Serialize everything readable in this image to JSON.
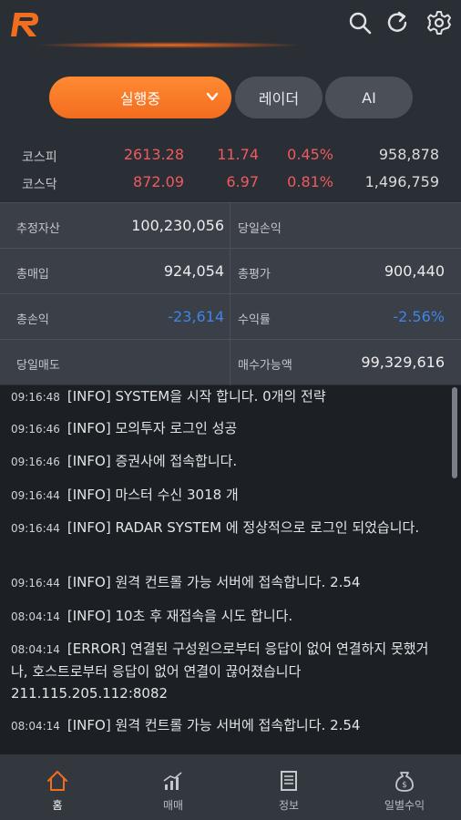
{
  "header": {
    "icons": [
      "search-icon",
      "refresh-icon",
      "settings-icon"
    ],
    "accent": "#f36d1f"
  },
  "tabs": [
    {
      "label": "실행중",
      "active": true
    },
    {
      "label": "레이더",
      "active": false
    },
    {
      "label": "AI",
      "active": false
    }
  ],
  "market": [
    {
      "name": "코스피",
      "value": "2613.28",
      "change": "11.74",
      "pct": "0.45%",
      "volume": "958,878"
    },
    {
      "name": "코스닥",
      "value": "872.09",
      "change": "6.97",
      "pct": "0.81%",
      "volume": "1,496,759"
    }
  ],
  "account": {
    "estimated_assets": {
      "label": "추정자산",
      "value": "100,230,056"
    },
    "daily_pnl": {
      "label": "당일손익",
      "value": ""
    },
    "total_buy": {
      "label": "총매입",
      "value": "924,054"
    },
    "total_eval": {
      "label": "총평가",
      "value": "900,440"
    },
    "total_pnl": {
      "label": "총손익",
      "value": "-23,614"
    },
    "return_rate": {
      "label": "수익률",
      "value": "-2.56%"
    },
    "daily_sell": {
      "label": "당일매도",
      "value": ""
    },
    "buyable": {
      "label": "매수가능액",
      "value": "99,329,616"
    }
  },
  "log": [
    {
      "time": "09:16:48",
      "message": "[INFO] SYSTEM을 시작 합니다. 0개의 전략"
    },
    {
      "time": "09:16:46",
      "message": "[INFO] 모의투자 로그인 성공"
    },
    {
      "time": "09:16:46",
      "message": "[INFO] 증권사에 접속합니다."
    },
    {
      "time": "09:16:44",
      "message": "[INFO] 마스터 수신 3018 개"
    },
    {
      "time": "09:16:44",
      "message": "[INFO] RADAR SYSTEM 에 정상적으로 로그인 되었습니다."
    },
    {
      "time": "09:16:44",
      "message": "[INFO] 원격 컨트롤 가능 서버에 접속합니다. 2.54"
    },
    {
      "time": "08:04:14",
      "message": "[INFO] 10초 후 재접속을 시도 합니다."
    },
    {
      "time": "08:04:14",
      "message": "[ERROR] 연결된 구성원으로부터 응답이 없어 연결하지 못했거나, 호스트로부터 응답이 없어 연결이 끊어졌습니다 211.115.205.112:8082"
    },
    {
      "time": "08:04:14",
      "message": "[INFO] 원격 컨트롤 가능 서버에 접속합니다. 2.54"
    }
  ],
  "nav": [
    {
      "label": "홈",
      "icon": "home-icon",
      "active": true
    },
    {
      "label": "매매",
      "icon": "trade-chart-icon",
      "active": false
    },
    {
      "label": "정보",
      "icon": "info-document-icon",
      "active": false
    },
    {
      "label": "일별수익",
      "icon": "money-bag-icon",
      "active": false
    }
  ]
}
